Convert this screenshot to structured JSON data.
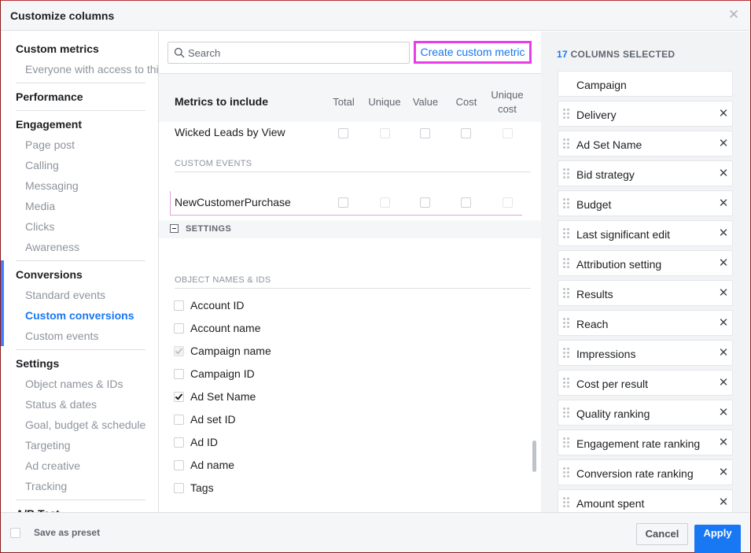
{
  "dialog": {
    "title": "Customize columns",
    "close_icon": "close-icon"
  },
  "nav": {
    "sections": [
      {
        "label": "Custom metrics",
        "items": [
          "Everyone with access to thi"
        ]
      },
      {
        "label": "Performance",
        "items": []
      },
      {
        "label": "Engagement",
        "items": [
          "Page post",
          "Calling",
          "Messaging",
          "Media",
          "Clicks",
          "Awareness"
        ]
      },
      {
        "label": "Conversions",
        "items": [
          "Standard events",
          "Custom conversions",
          "Custom events"
        ],
        "active_item": "Custom conversions"
      },
      {
        "label": "Settings",
        "items": [
          "Object names & IDs",
          "Status & dates",
          "Goal, budget & schedule",
          "Targeting",
          "Ad creative",
          "Tracking"
        ]
      },
      {
        "label": "A/B Test",
        "items": []
      }
    ]
  },
  "search": {
    "placeholder": "Search",
    "value": ""
  },
  "create_custom_metric_label": "Create custom metric",
  "metrics_table": {
    "heading": "Metrics to include",
    "columns": [
      "Total",
      "Unique",
      "Value",
      "Cost",
      "Unique cost"
    ],
    "rows": [
      {
        "label": "Wicked Leads by View"
      }
    ],
    "custom_events_header": "CUSTOM EVENTS",
    "custom_event_rows": [
      {
        "label": "NewCustomerPurchase"
      }
    ]
  },
  "settings_bar_label": "SETTINGS",
  "object_names": {
    "header": "OBJECT NAMES & IDS",
    "items": [
      {
        "label": "Account ID",
        "checked": false
      },
      {
        "label": "Account name",
        "checked": false
      },
      {
        "label": "Campaign name",
        "checked": true,
        "locked": true
      },
      {
        "label": "Campaign ID",
        "checked": false
      },
      {
        "label": "Ad Set Name",
        "checked": true
      },
      {
        "label": "Ad set ID",
        "checked": false
      },
      {
        "label": "Ad ID",
        "checked": false
      },
      {
        "label": "Ad name",
        "checked": false
      },
      {
        "label": "Tags",
        "checked": false
      }
    ]
  },
  "selected": {
    "count": "17",
    "count_label": "COLUMNS SELECTED",
    "columns": [
      {
        "label": "Campaign",
        "removable": false
      },
      {
        "label": "Delivery",
        "removable": true
      },
      {
        "label": "Ad Set Name",
        "removable": true
      },
      {
        "label": "Bid strategy",
        "removable": true
      },
      {
        "label": "Budget",
        "removable": true
      },
      {
        "label": "Last significant edit",
        "removable": true
      },
      {
        "label": "Attribution setting",
        "removable": true
      },
      {
        "label": "Results",
        "removable": true
      },
      {
        "label": "Reach",
        "removable": true
      },
      {
        "label": "Impressions",
        "removable": true
      },
      {
        "label": "Cost per result",
        "removable": true
      },
      {
        "label": "Quality ranking",
        "removable": true
      },
      {
        "label": "Engagement rate ranking",
        "removable": true
      },
      {
        "label": "Conversion rate ranking",
        "removable": true
      },
      {
        "label": "Amount spent",
        "removable": true
      }
    ]
  },
  "footer": {
    "save_preset_label": "Save as preset",
    "cancel_label": "Cancel",
    "apply_label": "Apply"
  },
  "colors": {
    "accent": "#1877f2",
    "highlight": "#e83ee8"
  }
}
